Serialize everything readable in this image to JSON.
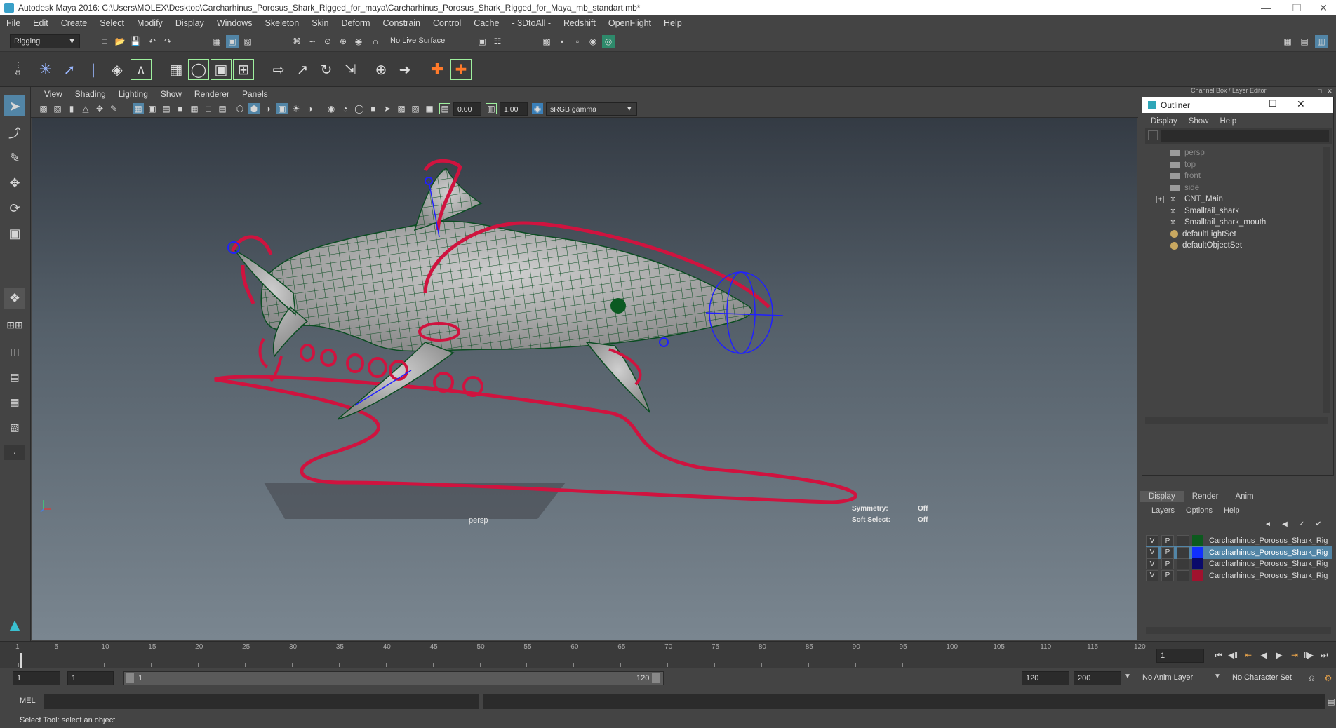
{
  "window": {
    "title": "Autodesk Maya 2016: C:\\Users\\MOLEX\\Desktop\\Carcharhinus_Porosus_Shark_Rigged_for_maya\\Carcharhinus_Porosus_Shark_Rigged_for_Maya_mb_standart.mb*"
  },
  "menubar": [
    "File",
    "Edit",
    "Create",
    "Select",
    "Modify",
    "Display",
    "Windows",
    "Skeleton",
    "Skin",
    "Deform",
    "Constrain",
    "Control",
    "Cache",
    "- 3DtoAll -",
    "Redshift",
    "OpenFlight",
    "Help"
  ],
  "statusline": {
    "mode": "Rigging",
    "live_surface": "No Live Surface"
  },
  "panel_menu": [
    "View",
    "Shading",
    "Lighting",
    "Show",
    "Renderer",
    "Panels"
  ],
  "panel_toolbar": {
    "exposure": "0.00",
    "gamma": "1.00",
    "colorspace": "sRGB gamma"
  },
  "viewport": {
    "camera_label": "persp",
    "symmetry_label": "Symmetry:",
    "symmetry_value": "Off",
    "soft_select_label": "Soft Select:",
    "soft_select_value": "Off"
  },
  "right_panel": {
    "header": "Channel Box / Layer Editor",
    "outliner": {
      "title": "Outliner",
      "menu": [
        "Display",
        "Show",
        "Help"
      ],
      "items": [
        {
          "label": "persp",
          "dim": true,
          "icon": "camera-icon"
        },
        {
          "label": "top",
          "dim": true,
          "icon": "camera-icon"
        },
        {
          "label": "front",
          "dim": true,
          "icon": "camera-icon"
        },
        {
          "label": "side",
          "dim": true,
          "icon": "camera-icon"
        },
        {
          "label": "CNT_Main",
          "dim": false,
          "icon": "group-icon",
          "expandable": true
        },
        {
          "label": "Smalltail_shark",
          "dim": false,
          "icon": "group-icon"
        },
        {
          "label": "Smalltail_shark_mouth",
          "dim": false,
          "icon": "group-icon"
        },
        {
          "label": "defaultLightSet",
          "dim": false,
          "icon": "set-icon"
        },
        {
          "label": "defaultObjectSet",
          "dim": false,
          "icon": "set-icon"
        }
      ]
    },
    "layer_tabs": [
      "Display",
      "Render",
      "Anim"
    ],
    "layer_menu": [
      "Layers",
      "Options",
      "Help"
    ],
    "layers": [
      {
        "v": "V",
        "p": "P",
        "color": "#0c5a1e",
        "name": "Carcharhinus_Porosus_Shark_Rig",
        "selected": false
      },
      {
        "v": "V",
        "p": "P",
        "color": "#1030ff",
        "name": "Carcharhinus_Porosus_Shark_Rig",
        "selected": true
      },
      {
        "v": "V",
        "p": "P",
        "color": "#0a0a6a",
        "name": "Carcharhinus_Porosus_Shark_Rig",
        "selected": false
      },
      {
        "v": "V",
        "p": "P",
        "color": "#a0122e",
        "name": "Carcharhinus_Porosus_Shark_Rig",
        "selected": false
      }
    ]
  },
  "timeline": {
    "ticks": [
      "1",
      "5",
      "10",
      "15",
      "20",
      "25",
      "30",
      "35",
      "40",
      "45",
      "50",
      "55",
      "60",
      "65",
      "70",
      "75",
      "80",
      "85",
      "90",
      "95",
      "100",
      "105",
      "110",
      "115",
      "120"
    ],
    "current_frame": "1"
  },
  "range": {
    "start": "1",
    "playback_start": "1",
    "slider_start": "1",
    "slider_end": "120",
    "playback_end": "120",
    "end": "200",
    "anim_layer": "No Anim Layer",
    "character_set": "No Character Set"
  },
  "cmdline": {
    "label": "MEL"
  },
  "helpline": {
    "text": "Select Tool: select an object"
  },
  "colors": {
    "rig_red": "#d0133f",
    "rig_blue": "#2020ff",
    "mesh_green": "#0b4d22",
    "accent": "#5285a6"
  }
}
